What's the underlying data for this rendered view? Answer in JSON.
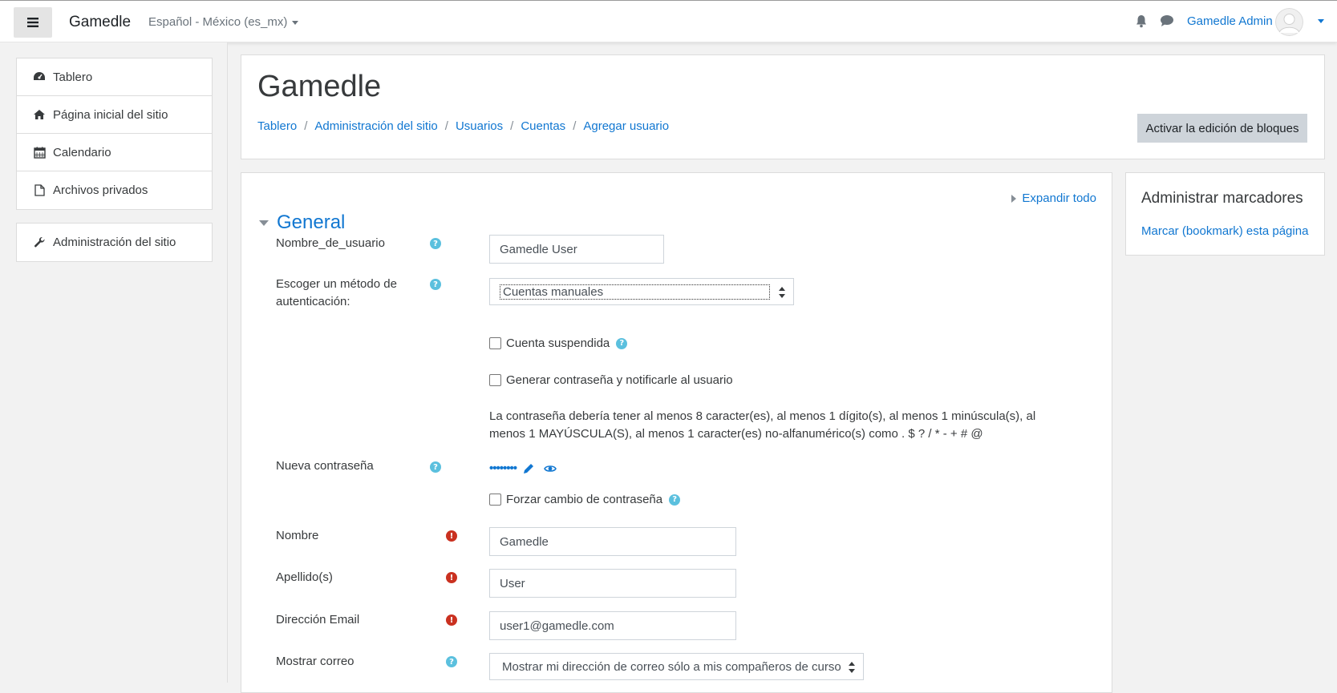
{
  "navbar": {
    "brand": "Gamedle",
    "language": "Español - México (es_mx)",
    "user_name": "Gamedle Admin",
    "icons": [
      "menu-icon",
      "bell-icon",
      "chat-icon",
      "avatar-icon"
    ]
  },
  "drawer": {
    "items": [
      {
        "label": "Tablero",
        "icon": "dashboard-icon"
      },
      {
        "label": "Página inicial del sitio",
        "icon": "home-icon"
      },
      {
        "label": "Calendario",
        "icon": "calendar-icon"
      },
      {
        "label": "Archivos privados",
        "icon": "file-icon"
      }
    ],
    "admin_item": {
      "label": "Administración del sitio",
      "icon": "wrench-icon"
    }
  },
  "header": {
    "title": "Gamedle",
    "breadcrumb": [
      "Tablero",
      "Administración del sitio",
      "Usuarios",
      "Cuentas",
      "Agregar usuario"
    ],
    "edit_button": "Activar la edición de bloques"
  },
  "form": {
    "expand_all": "Expandir todo",
    "section_title": "General",
    "username": {
      "label": "Nombre_de_usuario",
      "value": "Gamedle User"
    },
    "auth": {
      "label": "Escoger un método de autenticación:",
      "value": "Cuentas manuales"
    },
    "suspended": {
      "label": "Cuenta suspendida",
      "checked": false
    },
    "generate_pw": {
      "label": "Generar contraseña y notificarle al usuario",
      "checked": false
    },
    "pw_policy": "La contraseña debería tener al menos 8 caracter(es), al menos 1 dígito(s), al menos 1 minúscula(s), al menos 1 MAYÚSCULA(S), al menos 1 caracter(es) no-alfanumérico(s) como . $ ? / * - + # @",
    "new_password": {
      "label": "Nueva contraseña",
      "masked": "••••••••"
    },
    "force_change": {
      "label": "Forzar cambio de contraseña",
      "checked": false
    },
    "firstname": {
      "label": "Nombre",
      "value": "Gamedle"
    },
    "lastname": {
      "label": "Apellido(s)",
      "value": "User"
    },
    "email": {
      "label": "Dirección Email",
      "value": "user1@gamedle.com"
    },
    "maildisplay": {
      "label": "Mostrar correo",
      "value": "Mostrar mi dirección de correo sólo a mis compañeros de curso"
    }
  },
  "block": {
    "title": "Administrar marcadores",
    "link": "Marcar (bookmark) esta página"
  },
  "colors": {
    "link": "#1177d1",
    "help": "#5bc0de",
    "required": "#ca3120",
    "button_bg": "#ced4da"
  }
}
